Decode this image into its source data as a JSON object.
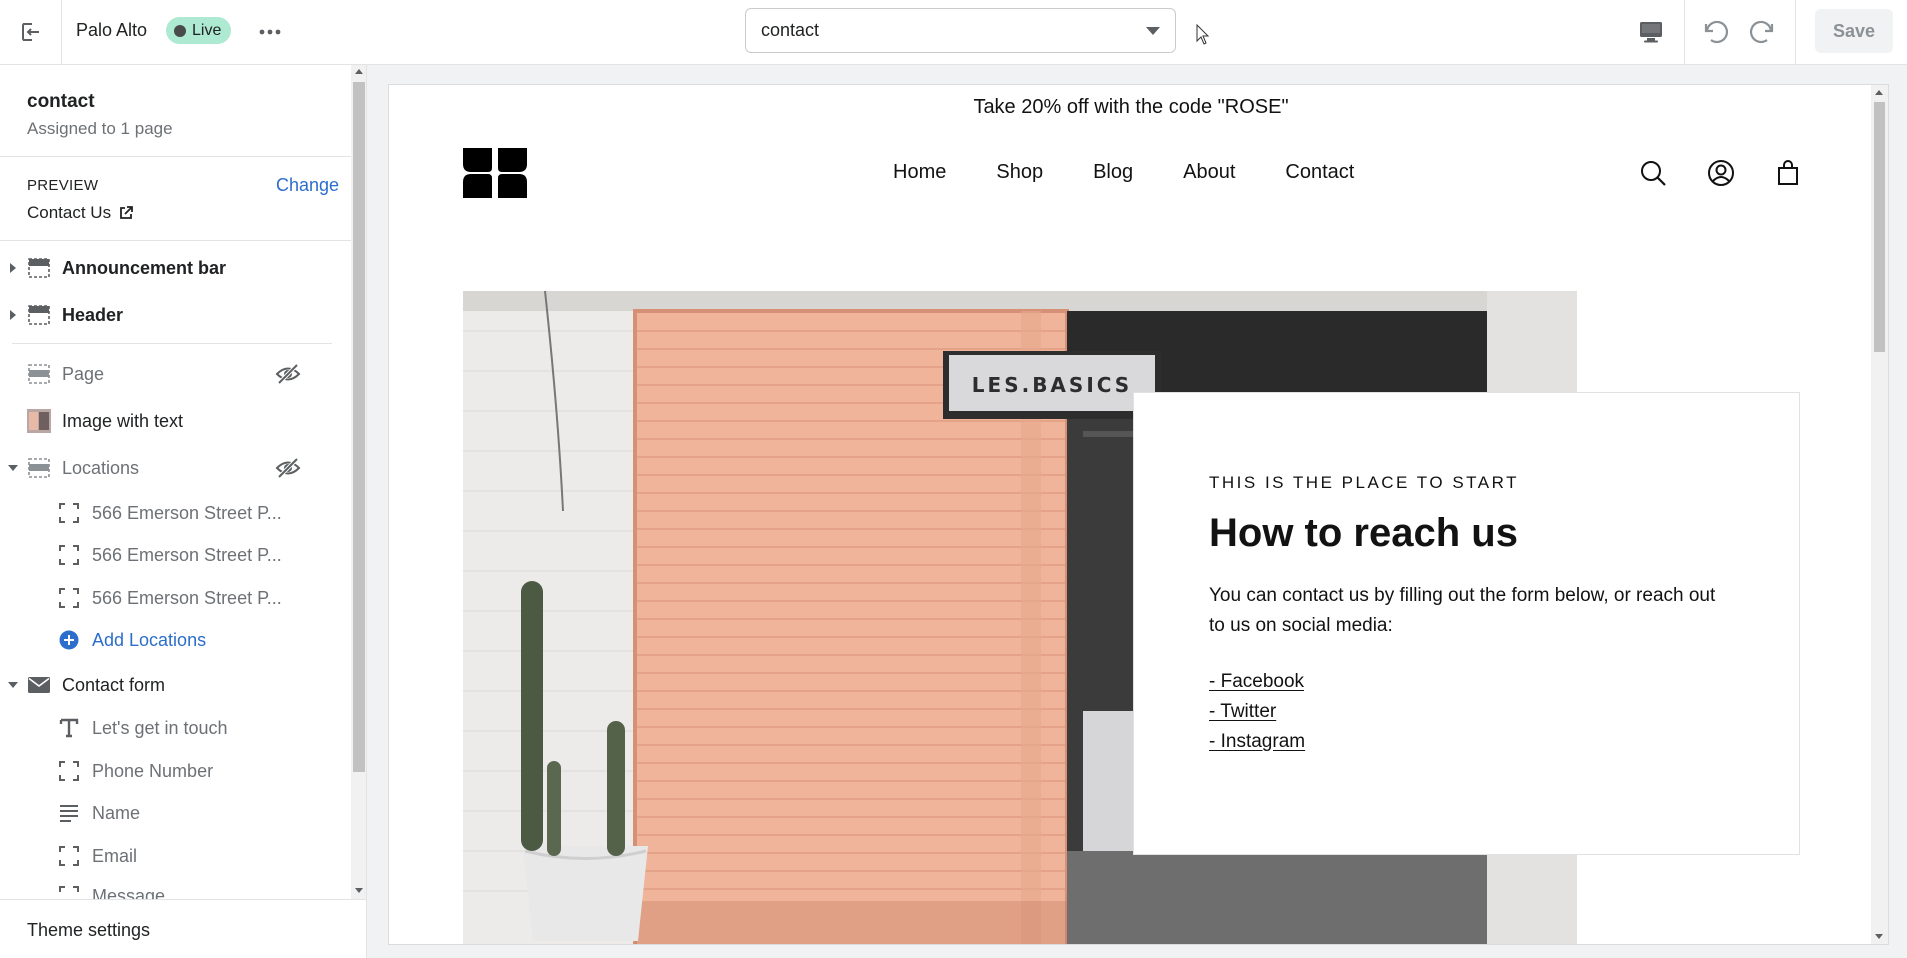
{
  "topbar": {
    "store_name": "Palo Alto",
    "status_badge": "Live",
    "template_select": "contact",
    "save_label": "Save"
  },
  "sidebar": {
    "template_name": "contact",
    "template_assigned": "Assigned to 1 page",
    "preview_label": "PREVIEW",
    "change_label": "Change",
    "preview_page": "Contact Us",
    "sections": {
      "announcement_bar": "Announcement bar",
      "header": "Header",
      "page": "Page",
      "image_with_text": "Image with text",
      "locations": "Locations",
      "location_items": [
        "566 Emerson Street P...",
        "566 Emerson Street P...",
        "566 Emerson Street P..."
      ],
      "add_locations": "Add Locations",
      "contact_form": "Contact form",
      "contact_form_blocks": [
        "Let's get in touch",
        "Phone Number",
        "Name",
        "Email",
        "Message"
      ]
    },
    "theme_settings": "Theme settings"
  },
  "preview": {
    "announcement": "Take 20% off with the code \"ROSE\"",
    "nav": [
      "Home",
      "Shop",
      "Blog",
      "About",
      "Contact"
    ],
    "hero_sign": "LES.BASICS",
    "card": {
      "eyebrow": "THIS IS THE PLACE TO START",
      "heading": "How to reach us",
      "body": "You can contact us by filling out the form below, or reach out to us on social media:",
      "links": [
        "- Facebook",
        "- Twitter",
        "- Instagram"
      ]
    }
  },
  "colors": {
    "live_badge": "#aee9d1",
    "link_blue": "#2c6ecb",
    "shutter_peach": "#f0b49a"
  },
  "icons": [
    "exit-icon",
    "more-icon",
    "dropdown-caret-icon",
    "desktop-icon",
    "undo-icon",
    "redo-icon",
    "external-link-icon",
    "section-icon",
    "eye-hidden-icon",
    "block-icon",
    "plus-circle-icon",
    "envelope-icon",
    "text-icon",
    "paragraph-icon",
    "search-icon",
    "account-icon",
    "bag-icon"
  ]
}
